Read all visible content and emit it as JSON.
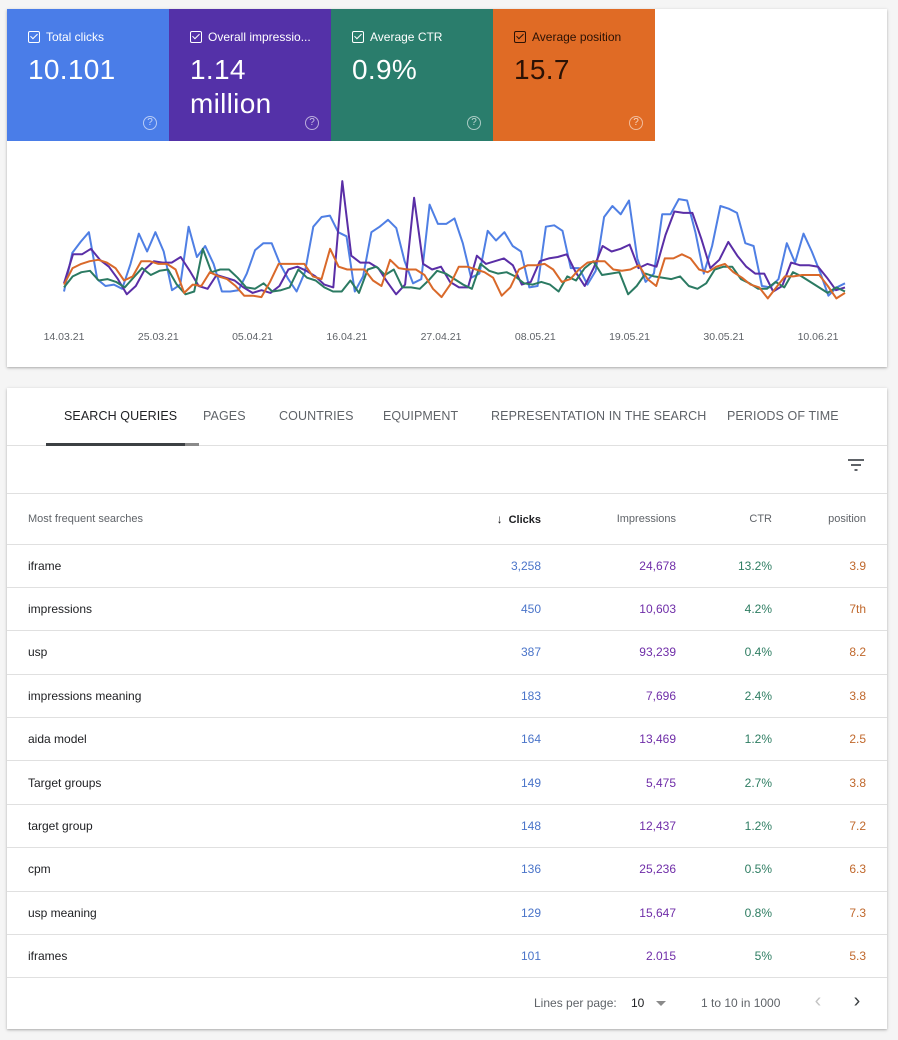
{
  "metrics": [
    {
      "label": "Total clicks",
      "value": "10.101",
      "color": "#4a7de8",
      "checked": true
    },
    {
      "label": "Overall impressio...",
      "value": "1.14 million",
      "color": "#5431a8",
      "checked": true
    },
    {
      "label": "Average CTR",
      "value": "0.9%",
      "color": "#2a7d6c",
      "checked": true
    },
    {
      "label": "Average position",
      "value": "15.7",
      "color": "#e06b25",
      "checked": true
    }
  ],
  "help_glyph": "?",
  "chart_data": {
    "type": "line",
    "title": "",
    "xlabel": "",
    "ylabel": "",
    "y_axis_visible": false,
    "grid": false,
    "legend": "none",
    "value_scale": "relative (0-100, no y-axis shown)",
    "x_start": "14.03.21",
    "x_end": "13.06.21",
    "x_tick_labels": [
      "14.03.21",
      "25.03.21",
      "05.04.21",
      "16.04.21",
      "27.04.21",
      "08.05.21",
      "19.05.21",
      "30.05.21",
      "10.06.21"
    ],
    "series": [
      {
        "name": "Total clicks",
        "color": "#4f7fe4",
        "values": [
          17,
          45,
          53,
          60,
          26,
          21,
          22,
          19,
          37,
          59,
          46,
          60,
          46,
          18,
          22,
          64,
          42,
          50,
          37,
          17,
          17,
          18,
          30,
          47,
          52,
          52,
          37,
          26,
          17,
          31,
          64,
          71,
          72,
          60,
          57,
          17,
          28,
          60,
          64,
          69,
          63,
          39,
          23,
          26,
          80,
          66,
          66,
          70,
          52,
          27,
          30,
          61,
          54,
          60,
          50,
          46,
          20,
          21,
          64,
          65,
          61,
          34,
          34,
          22,
          32,
          71,
          79,
          73,
          83,
          41,
          24,
          30,
          73,
          73,
          84,
          83,
          60,
          30,
          50,
          79,
          77,
          74,
          52,
          50,
          21,
          20,
          26,
          52,
          38,
          59,
          46,
          31,
          14,
          20,
          23
        ]
      },
      {
        "name": "Overall impressions",
        "color": "#5a2ea6",
        "values": [
          23,
          44,
          44,
          48,
          40,
          35,
          26,
          15,
          21,
          33,
          39,
          38,
          38,
          42,
          32,
          21,
          19,
          29,
          27,
          25,
          20,
          16,
          18,
          16,
          21,
          33,
          35,
          32,
          28,
          22,
          20,
          97,
          43,
          38,
          38,
          34,
          24,
          15,
          22,
          85,
          37,
          33,
          35,
          24,
          20,
          20,
          43,
          37,
          39,
          41,
          36,
          22,
          24,
          39,
          41,
          42,
          44,
          31,
          21,
          34,
          50,
          46,
          48,
          51,
          34,
          37,
          35,
          58,
          75,
          74,
          74,
          55,
          34,
          40,
          53,
          43,
          35,
          30,
          30,
          17,
          21,
          38,
          36,
          36,
          35,
          27,
          18,
          20
        ]
      },
      {
        "name": "Average CTR",
        "color": "#2b7a62",
        "values": [
          20,
          28,
          31,
          32,
          25,
          26,
          24,
          20,
          27,
          34,
          29,
          32,
          33,
          22,
          15,
          17,
          48,
          31,
          33,
          33,
          27,
          20,
          19,
          23,
          17,
          18,
          20,
          33,
          27,
          25,
          20,
          17,
          17,
          25,
          16,
          33,
          35,
          29,
          33,
          20,
          20,
          19,
          25,
          32,
          30,
          26,
          22,
          19,
          37,
          32,
          30,
          31,
          28,
          23,
          22,
          24,
          22,
          17,
          28,
          25,
          34,
          39,
          29,
          30,
          31,
          15,
          21,
          30,
          28,
          27,
          26,
          28,
          21,
          19,
          23,
          33,
          35,
          35,
          26,
          23,
          19,
          19,
          24,
          20,
          31,
          28,
          24,
          20,
          16,
          20,
          17
        ]
      },
      {
        "name": "Average position",
        "color": "#d9692a",
        "values": [
          22,
          34,
          37,
          39,
          40,
          38,
          34,
          25,
          28,
          39,
          39,
          37,
          37,
          33,
          16,
          22,
          21,
          31,
          28,
          26,
          21,
          14,
          14,
          13,
          24,
          37,
          37,
          37,
          37,
          28,
          26,
          48,
          35,
          33,
          33,
          33,
          25,
          21,
          40,
          34,
          33,
          33,
          29,
          19,
          13,
          22,
          35,
          35,
          33,
          31,
          27,
          14,
          20,
          33,
          36,
          36,
          37,
          33,
          24,
          26,
          33,
          38,
          39,
          39,
          33,
          32,
          33,
          36,
          26,
          21,
          41,
          41,
          44,
          41,
          33,
          31,
          35,
          37,
          31,
          27,
          22,
          20,
          12,
          20,
          28,
          28,
          29,
          29,
          29,
          21,
          12,
          16
        ]
      }
    ]
  },
  "tabs": [
    {
      "label": "SEARCH QUERIES",
      "active": true
    },
    {
      "label": "PAGES",
      "active": false
    },
    {
      "label": "COUNTRIES",
      "active": false
    },
    {
      "label": "EQUIPMENT",
      "active": false
    },
    {
      "label": "REPRESENTATION IN THE SEARCH",
      "active": false
    },
    {
      "label": "PERIODS OF TIME",
      "active": false
    }
  ],
  "filter_icon": "filter-icon",
  "table": {
    "columns": {
      "query": "Most frequent searches",
      "clicks": "Clicks",
      "impressions": "Impressions",
      "ctr": "CTR",
      "position": "position"
    },
    "sort_arrow": "↓",
    "sorted_by": "clicks",
    "rows": [
      {
        "query": "iframe",
        "clicks": "3,258",
        "impressions": "24,678",
        "ctr": "13.2%",
        "position": "3.9"
      },
      {
        "query": "impressions",
        "clicks": "450",
        "impressions": "10,603",
        "ctr": "4.2%",
        "position": "7th"
      },
      {
        "query": "usp",
        "clicks": "387",
        "impressions": "93,239",
        "ctr": "0.4%",
        "position": "8.2"
      },
      {
        "query": "impressions meaning",
        "clicks": "183",
        "impressions": "7,696",
        "ctr": "2.4%",
        "position": "3.8"
      },
      {
        "query": "aida model",
        "clicks": "164",
        "impressions": "13,469",
        "ctr": "1.2%",
        "position": "2.5"
      },
      {
        "query": "Target groups",
        "clicks": "149",
        "impressions": "5,475",
        "ctr": "2.7%",
        "position": "3.8"
      },
      {
        "query": "target group",
        "clicks": "148",
        "impressions": "12,437",
        "ctr": "1.2%",
        "position": "7.2"
      },
      {
        "query": "cpm",
        "clicks": "136",
        "impressions": "25,236",
        "ctr": "0.5%",
        "position": "6.3"
      },
      {
        "query": "usp meaning",
        "clicks": "129",
        "impressions": "15,647",
        "ctr": "0.8%",
        "position": "7.3"
      },
      {
        "query": "iframes",
        "clicks": "101",
        "impressions": "2.015",
        "ctr": "5%",
        "position": "5.3"
      }
    ]
  },
  "pagination": {
    "lines_per_page_label": "Lines per page:",
    "lines_per_page_value": "10",
    "range_text": "1 to 10 in 1000",
    "prev_glyph": "‹",
    "next_glyph": "›"
  }
}
